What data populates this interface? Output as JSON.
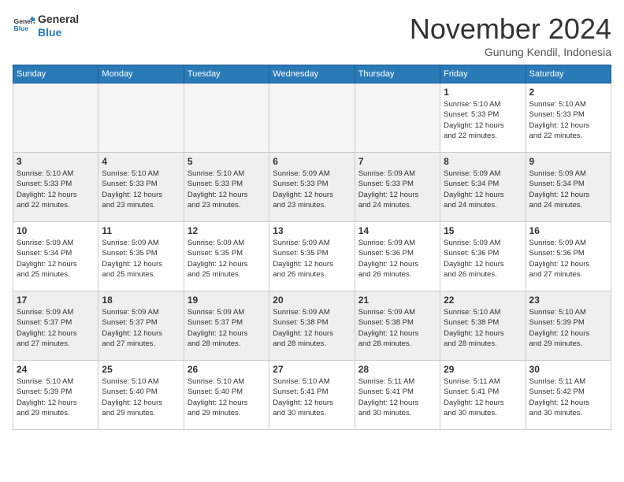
{
  "logo": {
    "line1": "General",
    "line2": "Blue"
  },
  "title": "November 2024",
  "subtitle": "Gunung Kendil, Indonesia",
  "weekdays": [
    "Sunday",
    "Monday",
    "Tuesday",
    "Wednesday",
    "Thursday",
    "Friday",
    "Saturday"
  ],
  "weeks": [
    [
      {
        "day": "",
        "info": ""
      },
      {
        "day": "",
        "info": ""
      },
      {
        "day": "",
        "info": ""
      },
      {
        "day": "",
        "info": ""
      },
      {
        "day": "",
        "info": ""
      },
      {
        "day": "1",
        "info": "Sunrise: 5:10 AM\nSunset: 5:33 PM\nDaylight: 12 hours\nand 22 minutes."
      },
      {
        "day": "2",
        "info": "Sunrise: 5:10 AM\nSunset: 5:33 PM\nDaylight: 12 hours\nand 22 minutes."
      }
    ],
    [
      {
        "day": "3",
        "info": "Sunrise: 5:10 AM\nSunset: 5:33 PM\nDaylight: 12 hours\nand 22 minutes."
      },
      {
        "day": "4",
        "info": "Sunrise: 5:10 AM\nSunset: 5:33 PM\nDaylight: 12 hours\nand 23 minutes."
      },
      {
        "day": "5",
        "info": "Sunrise: 5:10 AM\nSunset: 5:33 PM\nDaylight: 12 hours\nand 23 minutes."
      },
      {
        "day": "6",
        "info": "Sunrise: 5:09 AM\nSunset: 5:33 PM\nDaylight: 12 hours\nand 23 minutes."
      },
      {
        "day": "7",
        "info": "Sunrise: 5:09 AM\nSunset: 5:33 PM\nDaylight: 12 hours\nand 24 minutes."
      },
      {
        "day": "8",
        "info": "Sunrise: 5:09 AM\nSunset: 5:34 PM\nDaylight: 12 hours\nand 24 minutes."
      },
      {
        "day": "9",
        "info": "Sunrise: 5:09 AM\nSunset: 5:34 PM\nDaylight: 12 hours\nand 24 minutes."
      }
    ],
    [
      {
        "day": "10",
        "info": "Sunrise: 5:09 AM\nSunset: 5:34 PM\nDaylight: 12 hours\nand 25 minutes."
      },
      {
        "day": "11",
        "info": "Sunrise: 5:09 AM\nSunset: 5:35 PM\nDaylight: 12 hours\nand 25 minutes."
      },
      {
        "day": "12",
        "info": "Sunrise: 5:09 AM\nSunset: 5:35 PM\nDaylight: 12 hours\nand 25 minutes."
      },
      {
        "day": "13",
        "info": "Sunrise: 5:09 AM\nSunset: 5:35 PM\nDaylight: 12 hours\nand 26 minutes."
      },
      {
        "day": "14",
        "info": "Sunrise: 5:09 AM\nSunset: 5:36 PM\nDaylight: 12 hours\nand 26 minutes."
      },
      {
        "day": "15",
        "info": "Sunrise: 5:09 AM\nSunset: 5:36 PM\nDaylight: 12 hours\nand 26 minutes."
      },
      {
        "day": "16",
        "info": "Sunrise: 5:09 AM\nSunset: 5:36 PM\nDaylight: 12 hours\nand 27 minutes."
      }
    ],
    [
      {
        "day": "17",
        "info": "Sunrise: 5:09 AM\nSunset: 5:37 PM\nDaylight: 12 hours\nand 27 minutes."
      },
      {
        "day": "18",
        "info": "Sunrise: 5:09 AM\nSunset: 5:37 PM\nDaylight: 12 hours\nand 27 minutes."
      },
      {
        "day": "19",
        "info": "Sunrise: 5:09 AM\nSunset: 5:37 PM\nDaylight: 12 hours\nand 28 minutes."
      },
      {
        "day": "20",
        "info": "Sunrise: 5:09 AM\nSunset: 5:38 PM\nDaylight: 12 hours\nand 28 minutes."
      },
      {
        "day": "21",
        "info": "Sunrise: 5:09 AM\nSunset: 5:38 PM\nDaylight: 12 hours\nand 28 minutes."
      },
      {
        "day": "22",
        "info": "Sunrise: 5:10 AM\nSunset: 5:38 PM\nDaylight: 12 hours\nand 28 minutes."
      },
      {
        "day": "23",
        "info": "Sunrise: 5:10 AM\nSunset: 5:39 PM\nDaylight: 12 hours\nand 29 minutes."
      }
    ],
    [
      {
        "day": "24",
        "info": "Sunrise: 5:10 AM\nSunset: 5:39 PM\nDaylight: 12 hours\nand 29 minutes."
      },
      {
        "day": "25",
        "info": "Sunrise: 5:10 AM\nSunset: 5:40 PM\nDaylight: 12 hours\nand 29 minutes."
      },
      {
        "day": "26",
        "info": "Sunrise: 5:10 AM\nSunset: 5:40 PM\nDaylight: 12 hours\nand 29 minutes."
      },
      {
        "day": "27",
        "info": "Sunrise: 5:10 AM\nSunset: 5:41 PM\nDaylight: 12 hours\nand 30 minutes."
      },
      {
        "day": "28",
        "info": "Sunrise: 5:11 AM\nSunset: 5:41 PM\nDaylight: 12 hours\nand 30 minutes."
      },
      {
        "day": "29",
        "info": "Sunrise: 5:11 AM\nSunset: 5:41 PM\nDaylight: 12 hours\nand 30 minutes."
      },
      {
        "day": "30",
        "info": "Sunrise: 5:11 AM\nSunset: 5:42 PM\nDaylight: 12 hours\nand 30 minutes."
      }
    ]
  ]
}
